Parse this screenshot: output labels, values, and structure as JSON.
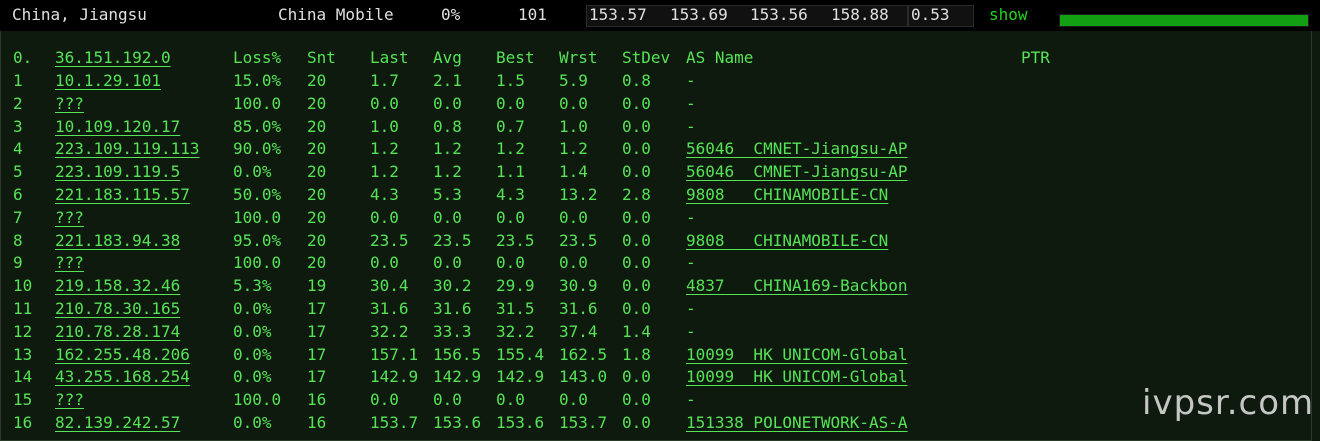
{
  "summary": {
    "location": "China, Jiangsu",
    "isp": "China Mobile",
    "loss": "0%",
    "sent": "101",
    "last": "153.57",
    "avg": "153.69",
    "best": "153.56",
    "worst": "158.88",
    "stdev": "0.53",
    "show_label": "show",
    "bar_fraction": 1.0
  },
  "headers": {
    "index": "0.",
    "host": "36.151.192.0",
    "loss": "Loss%",
    "snt": "Snt",
    "last": "Last",
    "avg": "Avg",
    "best": "Best",
    "wrst": "Wrst",
    "stdev": "StDev",
    "as_name": "AS Name",
    "ptr": "PTR"
  },
  "hops": [
    {
      "n": "1",
      "host": "10.1.29.101",
      "loss": "15.0%",
      "snt": "20",
      "last": "1.7",
      "avg": "2.1",
      "best": "1.5",
      "wrst": "5.9",
      "stdev": "0.8",
      "asn": "-"
    },
    {
      "n": "2",
      "host": "???",
      "loss": "100.0",
      "snt": "20",
      "last": "0.0",
      "avg": "0.0",
      "best": "0.0",
      "wrst": "0.0",
      "stdev": "0.0",
      "asn": "-"
    },
    {
      "n": "3",
      "host": "10.109.120.17",
      "loss": "85.0%",
      "snt": "20",
      "last": "1.0",
      "avg": "0.8",
      "best": "0.7",
      "wrst": "1.0",
      "stdev": "0.0",
      "asn": "-"
    },
    {
      "n": "4",
      "host": "223.109.119.113",
      "loss": "90.0%",
      "snt": "20",
      "last": "1.2",
      "avg": "1.2",
      "best": "1.2",
      "wrst": "1.2",
      "stdev": "0.0",
      "asn": "56046  CMNET-Jiangsu-AP"
    },
    {
      "n": "5",
      "host": "223.109.119.5",
      "loss": "0.0%",
      "snt": "20",
      "last": "1.2",
      "avg": "1.2",
      "best": "1.1",
      "wrst": "1.4",
      "stdev": "0.0",
      "asn": "56046  CMNET-Jiangsu-AP"
    },
    {
      "n": "6",
      "host": "221.183.115.57",
      "loss": "50.0%",
      "snt": "20",
      "last": "4.3",
      "avg": "5.3",
      "best": "4.3",
      "wrst": "13.2",
      "stdev": "2.8",
      "asn": "9808   CHINAMOBILE-CN"
    },
    {
      "n": "7",
      "host": "???",
      "loss": "100.0",
      "snt": "20",
      "last": "0.0",
      "avg": "0.0",
      "best": "0.0",
      "wrst": "0.0",
      "stdev": "0.0",
      "asn": "-"
    },
    {
      "n": "8",
      "host": "221.183.94.38",
      "loss": "95.0%",
      "snt": "20",
      "last": "23.5",
      "avg": "23.5",
      "best": "23.5",
      "wrst": "23.5",
      "stdev": "0.0",
      "asn": "9808   CHINAMOBILE-CN"
    },
    {
      "n": "9",
      "host": "???",
      "loss": "100.0",
      "snt": "20",
      "last": "0.0",
      "avg": "0.0",
      "best": "0.0",
      "wrst": "0.0",
      "stdev": "0.0",
      "asn": "-"
    },
    {
      "n": "10",
      "host": "219.158.32.46",
      "loss": "5.3%",
      "snt": "19",
      "last": "30.4",
      "avg": "30.2",
      "best": "29.9",
      "wrst": "30.9",
      "stdev": "0.0",
      "asn": "4837   CHINA169-Backbon"
    },
    {
      "n": "11",
      "host": "210.78.30.165",
      "loss": "0.0%",
      "snt": "17",
      "last": "31.6",
      "avg": "31.6",
      "best": "31.5",
      "wrst": "31.6",
      "stdev": "0.0",
      "asn": "-"
    },
    {
      "n": "12",
      "host": "210.78.28.174",
      "loss": "0.0%",
      "snt": "17",
      "last": "32.2",
      "avg": "33.3",
      "best": "32.2",
      "wrst": "37.4",
      "stdev": "1.4",
      "asn": "-"
    },
    {
      "n": "13",
      "host": "162.255.48.206",
      "loss": "0.0%",
      "snt": "17",
      "last": "157.1",
      "avg": "156.5",
      "best": "155.4",
      "wrst": "162.5",
      "stdev": "1.8",
      "asn": "10099  HK UNICOM-Global"
    },
    {
      "n": "14",
      "host": "43.255.168.254",
      "loss": "0.0%",
      "snt": "17",
      "last": "142.9",
      "avg": "142.9",
      "best": "142.9",
      "wrst": "143.0",
      "stdev": "0.0",
      "asn": "10099  HK UNICOM-Global"
    },
    {
      "n": "15",
      "host": "???",
      "loss": "100.0",
      "snt": "16",
      "last": "0.0",
      "avg": "0.0",
      "best": "0.0",
      "wrst": "0.0",
      "stdev": "0.0",
      "asn": "-"
    },
    {
      "n": "16",
      "host": "82.139.242.57",
      "loss": "0.0%",
      "snt": "16",
      "last": "153.7",
      "avg": "153.6",
      "best": "153.6",
      "wrst": "153.7",
      "stdev": "0.0",
      "asn": "151338 POLONETWORK-AS-A"
    }
  ],
  "watermark": "ivpsr.com",
  "colors": {
    "accent": "#56e356",
    "background": "#0e1a0e"
  }
}
